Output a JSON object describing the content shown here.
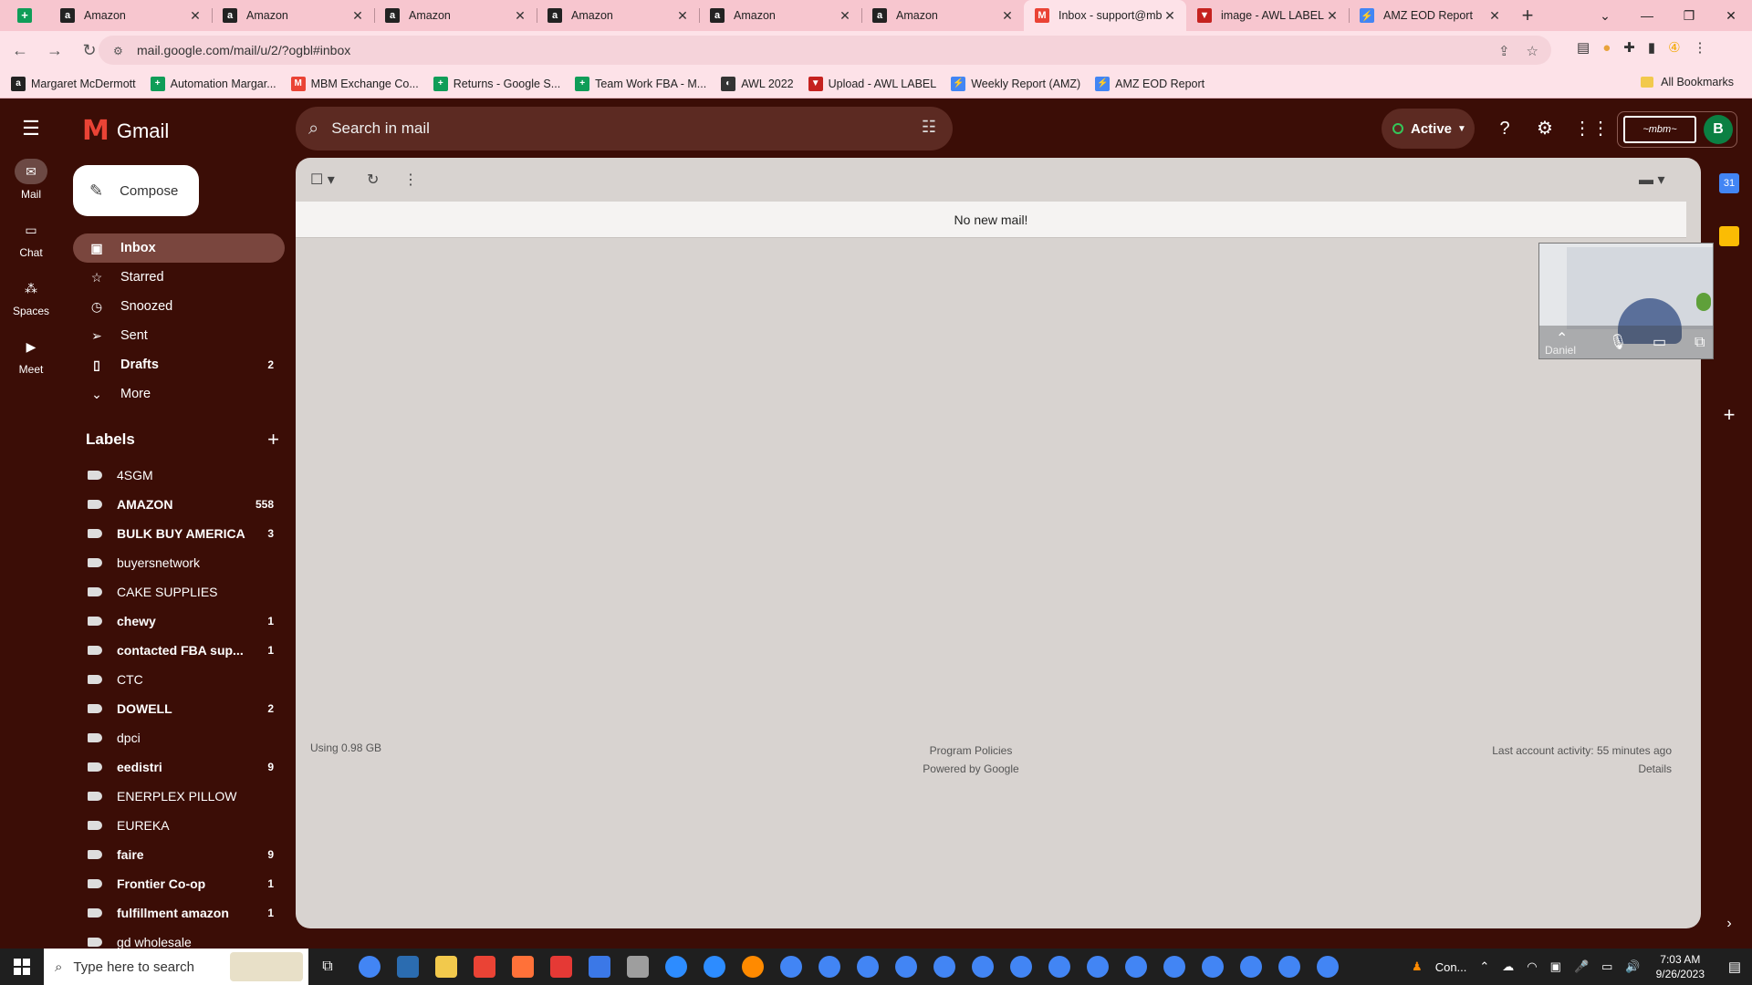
{
  "browser": {
    "tabs": [
      {
        "title": "Amazon",
        "fav": "a",
        "color": "#222222"
      },
      {
        "title": "Amazon",
        "fav": "a",
        "color": "#222222"
      },
      {
        "title": "Amazon",
        "fav": "a",
        "color": "#222222"
      },
      {
        "title": "Amazon",
        "fav": "a",
        "color": "#222222"
      },
      {
        "title": "Amazon",
        "fav": "a",
        "color": "#222222"
      },
      {
        "title": "Amazon",
        "fav": "a",
        "color": "#222222"
      },
      {
        "title": "Inbox - support@mbm",
        "fav": "M",
        "color": "#ea4335"
      },
      {
        "title": "image - AWL LABEL",
        "fav": "▼",
        "color": "#c5221f"
      },
      {
        "title": "AMZ EOD Report",
        "fav": "⚡",
        "color": "#4285f4"
      }
    ],
    "url": "mail.google.com/mail/u/2/?ogbl#inbox",
    "bookmarks": [
      {
        "label": "Margaret McDermott",
        "fav": "a",
        "color": "#222222"
      },
      {
        "label": "Automation Margar...",
        "fav": "+",
        "color": "#0f9d58"
      },
      {
        "label": "MBM Exchange Co...",
        "fav": "M",
        "color": "#ea4335"
      },
      {
        "label": "Returns - Google S...",
        "fav": "+",
        "color": "#0f9d58"
      },
      {
        "label": "Team Work FBA - M...",
        "fav": "+",
        "color": "#0f9d58"
      },
      {
        "label": "AWL 2022",
        "fav": "◐",
        "color": "#333333"
      },
      {
        "label": "Upload - AWL LABEL",
        "fav": "▼",
        "color": "#c5221f"
      },
      {
        "label": "Weekly Report (AMZ)",
        "fav": "⚡",
        "color": "#4285f4"
      },
      {
        "label": "AMZ EOD Report",
        "fav": "⚡",
        "color": "#4285f4"
      }
    ],
    "all_bookmarks": "All Bookmarks"
  },
  "rail": [
    {
      "label": "Mail",
      "icon": "mail-icon"
    },
    {
      "label": "Chat",
      "icon": "chat-icon"
    },
    {
      "label": "Spaces",
      "icon": "spaces-icon"
    },
    {
      "label": "Meet",
      "icon": "meet-icon"
    }
  ],
  "header": {
    "app_name": "Gmail",
    "search_placeholder": "Search in mail",
    "status": "Active",
    "avatar_letter": "B"
  },
  "compose_label": "Compose",
  "nav": [
    {
      "label": "Inbox",
      "icon": "▣",
      "count": "",
      "active": true,
      "bold": true
    },
    {
      "label": "Starred",
      "icon": "☆",
      "count": "",
      "active": false,
      "bold": false
    },
    {
      "label": "Snoozed",
      "icon": "◷",
      "count": "",
      "active": false,
      "bold": false
    },
    {
      "label": "Sent",
      "icon": "➢",
      "count": "",
      "active": false,
      "bold": false
    },
    {
      "label": "Drafts",
      "icon": "▯",
      "count": "2",
      "active": false,
      "bold": true
    },
    {
      "label": "More",
      "icon": "⌄",
      "count": "",
      "active": false,
      "bold": false
    }
  ],
  "labels_title": "Labels",
  "labels": [
    {
      "name": "4SGM",
      "count": "",
      "bold": false
    },
    {
      "name": "AMAZON",
      "count": "558",
      "bold": true
    },
    {
      "name": "BULK BUY AMERICA",
      "count": "3",
      "bold": true
    },
    {
      "name": "buyersnetwork",
      "count": "",
      "bold": false
    },
    {
      "name": "CAKE SUPPLIES",
      "count": "",
      "bold": false
    },
    {
      "name": "chewy",
      "count": "1",
      "bold": true
    },
    {
      "name": "contacted FBA sup...",
      "count": "1",
      "bold": true
    },
    {
      "name": "CTC",
      "count": "",
      "bold": false
    },
    {
      "name": "DOWELL",
      "count": "2",
      "bold": true
    },
    {
      "name": "dpci",
      "count": "",
      "bold": false
    },
    {
      "name": "eedistri",
      "count": "9",
      "bold": true
    },
    {
      "name": "ENERPLEX PILLOW",
      "count": "",
      "bold": false
    },
    {
      "name": "EUREKA",
      "count": "",
      "bold": false
    },
    {
      "name": "faire",
      "count": "9",
      "bold": true
    },
    {
      "name": "Frontier Co-op",
      "count": "1",
      "bold": true
    },
    {
      "name": "fulfillment amazon",
      "count": "1",
      "bold": true
    },
    {
      "name": "gd wholesale",
      "count": "",
      "bold": false
    }
  ],
  "main": {
    "empty_message": "No new mail!",
    "storage": "Using 0.98 GB",
    "program_policies": "Program Policies",
    "powered_by": "Powered by Google",
    "last_activity": "Last account activity: 55 minutes ago",
    "details": "Details"
  },
  "video_tile": {
    "name": "Daniel"
  },
  "taskbar": {
    "search_placeholder": "Type here to search",
    "app_colors": [
      "#4285f4",
      "#2b6cb0",
      "#f2c94c",
      "#ea4335",
      "#ff7139",
      "#e53935",
      "#3b78e7",
      "#9e9e9e",
      "#2d8cff",
      "#2d8cff",
      "#ff8a00",
      "#4285f4",
      "#4285f4",
      "#4285f4",
      "#4285f4",
      "#4285f4",
      "#4285f4",
      "#4285f4",
      "#4285f4",
      "#4285f4",
      "#4285f4",
      "#4285f4",
      "#4285f4",
      "#4285f4",
      "#4285f4",
      "#4285f4"
    ],
    "tray_app": "Con...",
    "time": "7:03 AM",
    "date": "9/26/2023"
  }
}
